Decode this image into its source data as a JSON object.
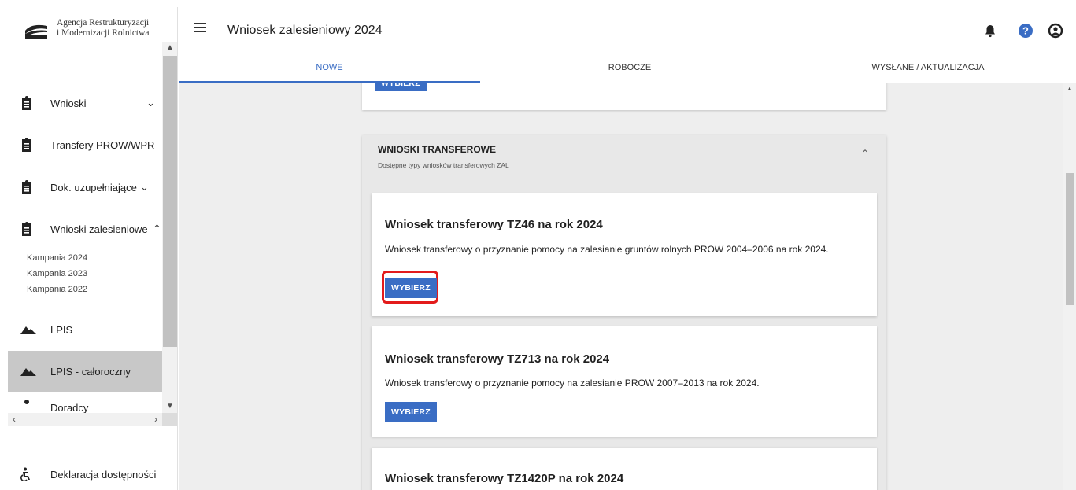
{
  "logo": {
    "text": "Agencja Restrukturyzacji\ni Modernizacji Rolnictwa",
    "mark_label": "ARiMR"
  },
  "sidebar": {
    "items": [
      {
        "label": "Wnioski",
        "icon": "clipboard-icon",
        "chevron": "⌄"
      },
      {
        "label": "Transfery PROW/WPR",
        "icon": "clipboard-icon",
        "chevron": ""
      },
      {
        "label": "Dok. uzupełniające",
        "icon": "clipboard-icon",
        "chevron": "⌄"
      },
      {
        "label": "Wnioski zalesieniowe",
        "icon": "clipboard-icon",
        "chevron": "⌃"
      },
      {
        "label": "LPIS",
        "icon": "mountain-icon",
        "chevron": ""
      },
      {
        "label": "LPIS - całoroczny",
        "icon": "mountain-icon",
        "chevron": ""
      },
      {
        "label": "Doradcy",
        "icon": "dot-icon",
        "chevron": ""
      }
    ],
    "sub_items": [
      "Kampania 2024",
      "Kampania 2023",
      "Kampania 2022"
    ],
    "footer": {
      "label": "Deklaracja dostępności",
      "icon": "accessibility-icon"
    }
  },
  "header": {
    "title": "Wniosek zalesieniowy 2024",
    "icons": [
      "bell-icon",
      "help-icon",
      "account-icon"
    ]
  },
  "tabs": [
    {
      "label": "NOWE",
      "active": true
    },
    {
      "label": "ROBOCZE",
      "active": false
    },
    {
      "label": "WYSŁANE / AKTUALIZACJA",
      "active": false
    }
  ],
  "content": {
    "prev_card_button": "WYBIERZ",
    "panel": {
      "title": "WNIOSKI TRANSFEROWE",
      "subtitle": "Dostępne typy wniosków transferowych ZAL"
    },
    "cards": [
      {
        "title": "Wniosek transferowy TZ46 na rok 2024",
        "description": "Wniosek transferowy o przyznanie pomocy na zalesianie gruntów rolnych PROW 2004–2006 na rok 2024.",
        "button": "WYBIERZ"
      },
      {
        "title": "Wniosek transferowy TZ713 na rok 2024",
        "description": "Wniosek transferowy o przyznanie pomocy na zalesianie PROW 2007–2013 na rok 2024.",
        "button": "WYBIERZ"
      },
      {
        "title": "Wniosek transferowy TZ1420P na rok 2024",
        "description": "",
        "button": ""
      }
    ]
  },
  "colors": {
    "accent": "#3a6dc4",
    "highlight": "#e31b1b",
    "active_nav": "#c8c8c8",
    "content_bg": "#eeeeee"
  }
}
